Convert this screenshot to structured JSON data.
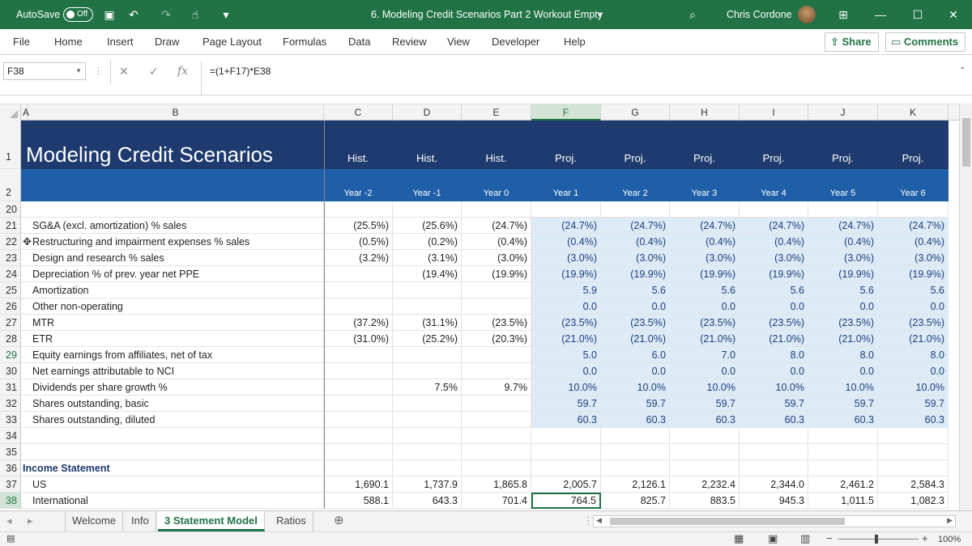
{
  "titlebar": {
    "autosave_label": "AutoSave",
    "autosave_state": "Off",
    "doc_title": "6. Modeling Credit Scenarios Part 2 Workout Empty",
    "user": "Chris Cordone"
  },
  "ribbon": {
    "menus": [
      "File",
      "Home",
      "Insert",
      "Draw",
      "Page Layout",
      "Formulas",
      "Data",
      "Review",
      "View",
      "Developer",
      "Help"
    ],
    "share_label": "Share",
    "comments_label": "Comments"
  },
  "formula_bar": {
    "name_box": "F38",
    "fx": "fx",
    "formula": "=(1+F17)*E38"
  },
  "columns": [
    "A",
    "B",
    "C",
    "D",
    "E",
    "F",
    "G",
    "H",
    "I",
    "J",
    "K"
  ],
  "header": {
    "title": "Modeling Credit Scenarios",
    "labels": [
      "Hist.",
      "Hist.",
      "Hist.",
      "Proj.",
      "Proj.",
      "Proj.",
      "Proj.",
      "Proj.",
      "Proj."
    ],
    "years": [
      "Year -2",
      "Year -1",
      "Year 0",
      "Year 1",
      "Year 2",
      "Year 3",
      "Year 4",
      "Year 5",
      "Year 6"
    ]
  },
  "rows": [
    {
      "n": "20",
      "label": "",
      "vals": [
        "",
        "",
        "",
        "",
        "",
        "",
        "",
        "",
        ""
      ]
    },
    {
      "n": "21",
      "label": "SG&A (excl. amortization) % sales",
      "vals": [
        "(25.5%)",
        "(25.6%)",
        "(24.7%)",
        "(24.7%)",
        "(24.7%)",
        "(24.7%)",
        "(24.7%)",
        "(24.7%)",
        "(24.7%)"
      ]
    },
    {
      "n": "22",
      "label": "Restructuring and impairment expenses % sales",
      "vals": [
        "(0.5%)",
        "(0.2%)",
        "(0.4%)",
        "(0.4%)",
        "(0.4%)",
        "(0.4%)",
        "(0.4%)",
        "(0.4%)",
        "(0.4%)"
      ]
    },
    {
      "n": "23",
      "label": "Design and research % sales",
      "vals": [
        "(3.2%)",
        "(3.1%)",
        "(3.0%)",
        "(3.0%)",
        "(3.0%)",
        "(3.0%)",
        "(3.0%)",
        "(3.0%)",
        "(3.0%)"
      ]
    },
    {
      "n": "24",
      "label": "Depreciation % of prev. year net PPE",
      "vals": [
        "",
        "(19.4%)",
        "(19.9%)",
        "(19.9%)",
        "(19.9%)",
        "(19.9%)",
        "(19.9%)",
        "(19.9%)",
        "(19.9%)"
      ]
    },
    {
      "n": "25",
      "label": "Amortization",
      "vals": [
        "",
        "",
        "",
        "5.9",
        "5.6",
        "5.6",
        "5.6",
        "5.6",
        "5.6"
      ]
    },
    {
      "n": "26",
      "label": "Other non-operating",
      "vals": [
        "",
        "",
        "",
        "0.0",
        "0.0",
        "0.0",
        "0.0",
        "0.0",
        "0.0"
      ]
    },
    {
      "n": "27",
      "label": "MTR",
      "vals": [
        "(37.2%)",
        "(31.1%)",
        "(23.5%)",
        "(23.5%)",
        "(23.5%)",
        "(23.5%)",
        "(23.5%)",
        "(23.5%)",
        "(23.5%)"
      ]
    },
    {
      "n": "28",
      "label": "ETR",
      "vals": [
        "(31.0%)",
        "(25.2%)",
        "(20.3%)",
        "(21.0%)",
        "(21.0%)",
        "(21.0%)",
        "(21.0%)",
        "(21.0%)",
        "(21.0%)"
      ]
    },
    {
      "n": "29",
      "label": "Equity earnings from affiliates, net of tax",
      "vals": [
        "",
        "",
        "",
        "5.0",
        "6.0",
        "7.0",
        "8.0",
        "8.0",
        "8.0"
      ]
    },
    {
      "n": "30",
      "label": "Net earnings attributable to NCI",
      "vals": [
        "",
        "",
        "",
        "0.0",
        "0.0",
        "0.0",
        "0.0",
        "0.0",
        "0.0"
      ]
    },
    {
      "n": "31",
      "label": "Dividends per share growth %",
      "vals": [
        "",
        "7.5%",
        "9.7%",
        "10.0%",
        "10.0%",
        "10.0%",
        "10.0%",
        "10.0%",
        "10.0%"
      ]
    },
    {
      "n": "32",
      "label": "Shares outstanding, basic",
      "vals": [
        "",
        "",
        "",
        "59.7",
        "59.7",
        "59.7",
        "59.7",
        "59.7",
        "59.7"
      ]
    },
    {
      "n": "33",
      "label": "Shares outstanding, diluted",
      "vals": [
        "",
        "",
        "",
        "60.3",
        "60.3",
        "60.3",
        "60.3",
        "60.3",
        "60.3"
      ]
    },
    {
      "n": "34",
      "label": "",
      "vals": [
        "",
        "",
        "",
        "",
        "",
        "",
        "",
        "",
        ""
      ]
    },
    {
      "n": "35",
      "label": "",
      "vals": [
        "",
        "",
        "",
        "",
        "",
        "",
        "",
        "",
        ""
      ]
    },
    {
      "n": "36",
      "label": "Income Statement",
      "vals": [
        "",
        "",
        "",
        "",
        "",
        "",
        "",
        "",
        ""
      ]
    },
    {
      "n": "37",
      "label": "US",
      "vals": [
        "1,690.1",
        "1,737.9",
        "1,865.8",
        "2,005.7",
        "2,126.1",
        "2,232.4",
        "2,344.0",
        "2,461.2",
        "2,584.3"
      ]
    },
    {
      "n": "38",
      "label": "International",
      "vals": [
        "588.1",
        "643.3",
        "701.4",
        "764.5",
        "825.7",
        "883.5",
        "945.3",
        "1,011.5",
        "1,082.3"
      ]
    }
  ],
  "tabs": [
    "Welcome",
    "Info",
    "3 Statement Model",
    "Ratios"
  ],
  "active_tab": "3 Statement Model",
  "status": {
    "zoom": "100%"
  }
}
